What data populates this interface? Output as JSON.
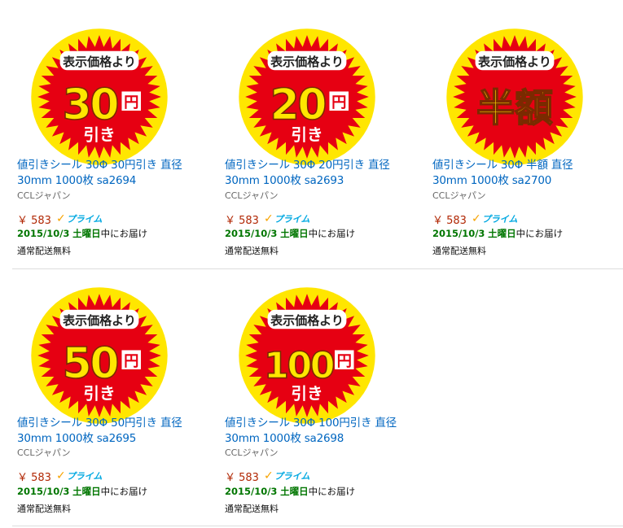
{
  "products": [
    {
      "title_line1": "値引きシール 30Φ 30円引き 直径",
      "title_line2": "30mm 1000枚 sa2694",
      "brand": "CCLジャパン",
      "price": "￥ 583",
      "prime_label": "プライム",
      "delivery_date": "2015/10/3",
      "delivery_day": "土曜日",
      "delivery_suffix": "中にお届け",
      "shipping": "通常配送無料",
      "badge": {
        "top": "表示価格より",
        "main": "30",
        "unit": "円",
        "bottom": "引き"
      }
    },
    {
      "title_line1": "値引きシール 30Φ 20円引き 直径",
      "title_line2": "30mm 1000枚 sa2693",
      "brand": "CCLジャパン",
      "price": "￥ 583",
      "prime_label": "プライム",
      "delivery_date": "2015/10/3",
      "delivery_day": "土曜日",
      "delivery_suffix": "中にお届け",
      "shipping": "通常配送無料",
      "badge": {
        "top": "表示価格より",
        "main": "20",
        "unit": "円",
        "bottom": "引き"
      }
    },
    {
      "title_line1": "値引きシール 30Φ 半額 直径",
      "title_line2": "30mm 1000枚 sa2700",
      "brand": "CCLジャパン",
      "price": "￥ 583",
      "prime_label": "プライム",
      "delivery_date": "2015/10/3",
      "delivery_day": "土曜日",
      "delivery_suffix": "中にお届け",
      "shipping": "通常配送無料",
      "badge": {
        "top": "表示価格より",
        "main": "半額",
        "unit": "",
        "bottom": ""
      }
    },
    {
      "title_line1": "値引きシール 30Φ 50円引き 直径",
      "title_line2": "30mm 1000枚 sa2695",
      "brand": "CCLジャパン",
      "price": "￥ 583",
      "prime_label": "プライム",
      "delivery_date": "2015/10/3",
      "delivery_day": "土曜日",
      "delivery_suffix": "中にお届け",
      "shipping": "通常配送無料",
      "badge": {
        "top": "表示価格より",
        "main": "50",
        "unit": "円",
        "bottom": "引き"
      }
    },
    {
      "title_line1": "値引きシール 30Φ 100円引き 直径",
      "title_line2": "30mm 1000枚 sa2698",
      "brand": "CCLジャパン",
      "price": "￥ 583",
      "prime_label": "プライム",
      "delivery_date": "2015/10/3",
      "delivery_day": "土曜日",
      "delivery_suffix": "中にお届け",
      "shipping": "通常配送無料",
      "badge": {
        "top": "表示価格より",
        "main": "100",
        "unit": "円",
        "bottom": "引き"
      }
    }
  ],
  "colors": {
    "badge_red": "#e60012",
    "badge_yellow": "#ffe600",
    "link_blue": "#0066c0",
    "price_red": "#b12704",
    "delivery_green": "#007600",
    "prime_blue": "#00a8e1",
    "prime_orange": "#f7a300"
  },
  "icons": {
    "prime": "prime-check-icon"
  }
}
